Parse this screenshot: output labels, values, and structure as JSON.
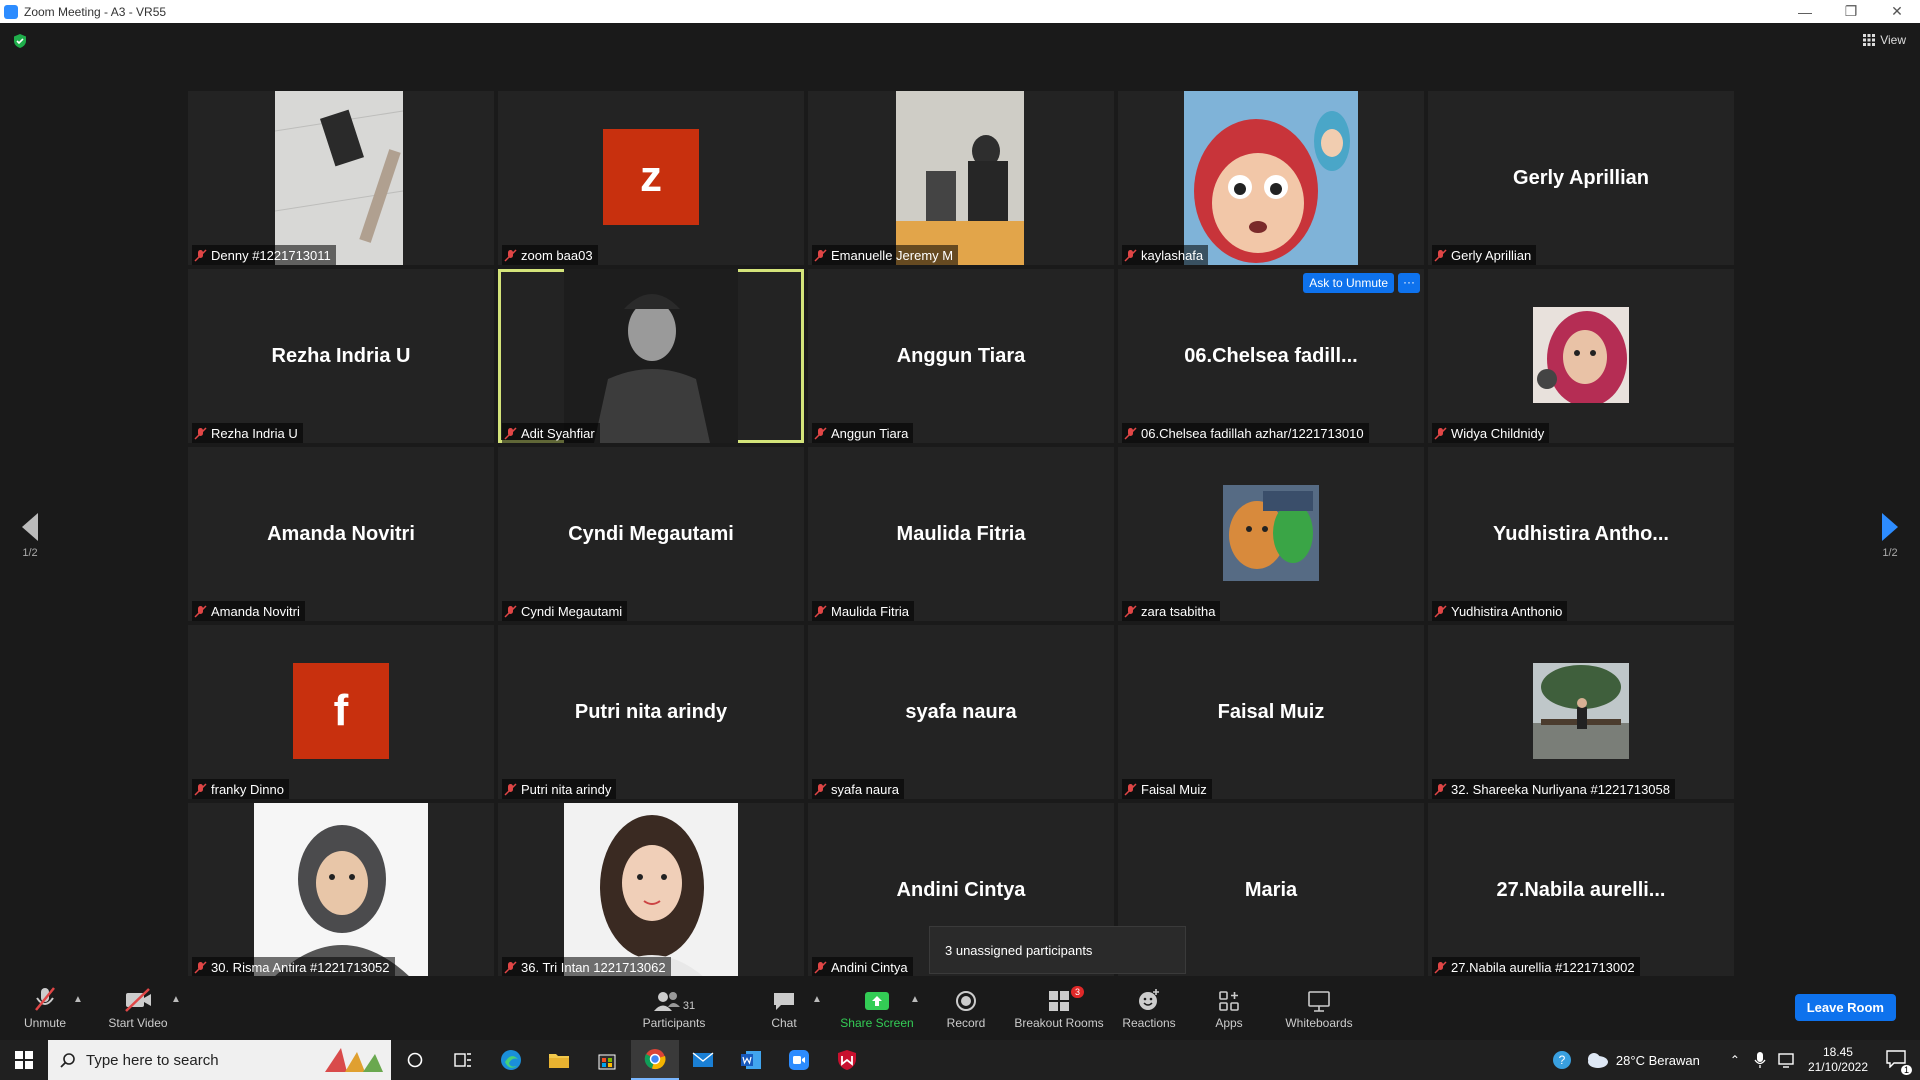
{
  "window": {
    "title": "Zoom Meeting - A3 - VR55"
  },
  "header": {
    "view_label": "View"
  },
  "tiles": [
    {
      "display": "",
      "label": "Denny #1221713011",
      "kind": "photo"
    },
    {
      "display": "z",
      "label": "zoom baa03",
      "kind": "avatar"
    },
    {
      "display": "",
      "label": "Emanuelle Jeremy M",
      "kind": "photo"
    },
    {
      "display": "",
      "label": "kaylashafa",
      "kind": "photo"
    },
    {
      "display": "Gerly Aprillian",
      "label": "Gerly Aprillian",
      "kind": "name"
    },
    {
      "display": "Rezha Indria U",
      "label": "Rezha Indria U",
      "kind": "name"
    },
    {
      "display": "",
      "label": "Adit Syahfiar",
      "kind": "photo",
      "active": true
    },
    {
      "display": "Anggun Tiara",
      "label": "Anggun Tiara",
      "kind": "name"
    },
    {
      "display": "06.Chelsea  fadill...",
      "label": "06.Chelsea fadillah azhar/1221713010",
      "kind": "name"
    },
    {
      "display": "",
      "label": "Widya Childnidy",
      "kind": "small-photo"
    },
    {
      "display": "Amanda Novitri",
      "label": "Amanda Novitri",
      "kind": "name"
    },
    {
      "display": "Cyndi Megautami",
      "label": "Cyndi Megautami",
      "kind": "name"
    },
    {
      "display": "Maulida Fitria",
      "label": "Maulida Fitria",
      "kind": "name"
    },
    {
      "display": "",
      "label": "zara tsabitha",
      "kind": "small-photo"
    },
    {
      "display": "Yudhistira  Antho...",
      "label": "Yudhistira Anthonio",
      "kind": "name"
    },
    {
      "display": "f",
      "label": "franky Dinno",
      "kind": "avatar"
    },
    {
      "display": "Putri nita arindy",
      "label": "Putri nita arindy",
      "kind": "name"
    },
    {
      "display": "syafa naura",
      "label": "syafa naura",
      "kind": "name"
    },
    {
      "display": "Faisal Muiz",
      "label": "Faisal Muiz",
      "kind": "name"
    },
    {
      "display": "",
      "label": "32. Shareeka Nurliyana #1221713058",
      "kind": "small-photo"
    },
    {
      "display": "",
      "label": "30. Risma Antira #1221713052",
      "kind": "photo"
    },
    {
      "display": "",
      "label": "36. Tri Intan 1221713062",
      "kind": "photo"
    },
    {
      "display": "Andini Cintya",
      "label": "Andini Cintya",
      "kind": "name"
    },
    {
      "display": "Maria",
      "label": "",
      "kind": "name"
    },
    {
      "display": "27.Nabila  aurelli...",
      "label": "27.Nabila aurellia #1221713002",
      "kind": "name"
    }
  ],
  "chelsea_actions": {
    "ask_unmute": "Ask to Unmute",
    "more": "···"
  },
  "pager": {
    "left": "1/2",
    "right": "1/2"
  },
  "toast": {
    "text": "3 unassigned participants"
  },
  "toolbar": {
    "unmute": "Unmute",
    "start_video": "Start Video",
    "participants": "Participants",
    "participants_count": "31",
    "chat": "Chat",
    "share_screen": "Share Screen",
    "record": "Record",
    "breakout_rooms": "Breakout Rooms",
    "breakout_badge": "3",
    "reactions": "Reactions",
    "apps": "Apps",
    "whiteboards": "Whiteboards",
    "leave": "Leave Room"
  },
  "taskbar": {
    "search_placeholder": "Type here to search",
    "weather": "28°C  Berawan",
    "time": "18.45",
    "date": "21/10/2022",
    "notifications": "1"
  },
  "colors": {
    "accent": "#0e72ed",
    "active_border": "#d4e47a",
    "avatar": "#c8300e",
    "green": "#33cc55"
  }
}
